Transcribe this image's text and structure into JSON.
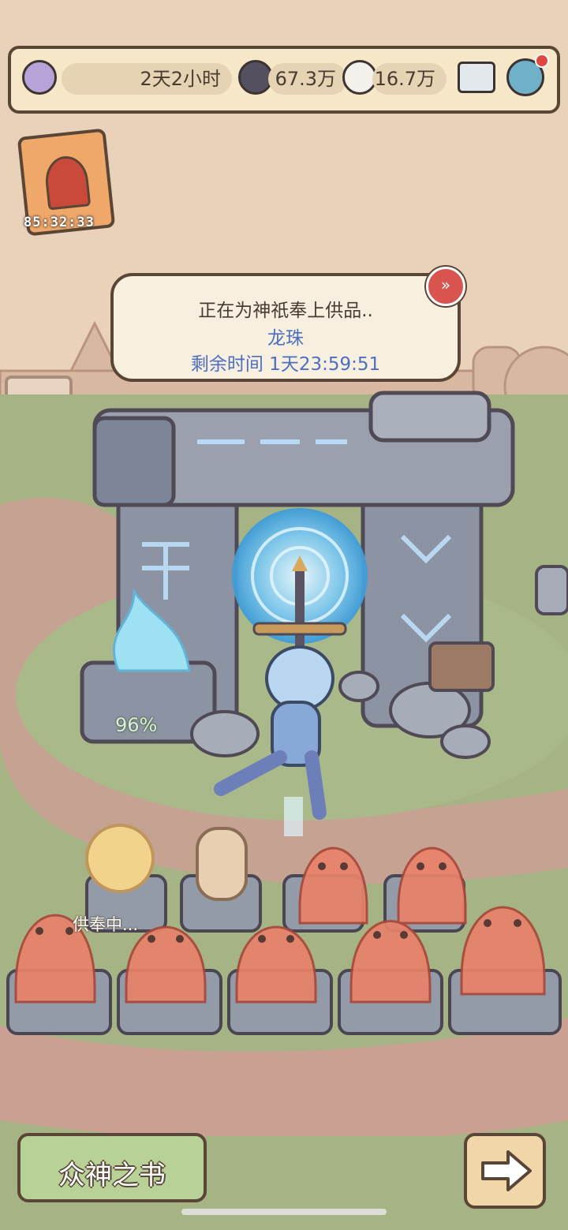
{
  "topbar": {
    "time_remaining": "2天2小时",
    "currency1": "67.3万",
    "currency2": "16.7万",
    "mail_icon": "mail-icon",
    "settings_icon": "gear-icon"
  },
  "event_card": {
    "timer": "85:32:33",
    "icon": "carrot-card-icon"
  },
  "offering_bubble": {
    "line1": "正在为神祇奉上供品..",
    "item": "龙珠",
    "remaining": "剩余时间  1天23:59:51",
    "skip_icon": "fast-forward-icon"
  },
  "altar": {
    "flame_percent": "96%",
    "offering_status": "供奉中..."
  },
  "bottom": {
    "book_label": "众神之书",
    "next_icon": "arrow-right-icon"
  },
  "colors": {
    "frame": "#5a4636",
    "bubble_text": "#4e6fc0",
    "ghost": "#e9826a",
    "portal": "#8fd0f0",
    "grass": "#9fae7e",
    "path": "#c89c8c"
  }
}
